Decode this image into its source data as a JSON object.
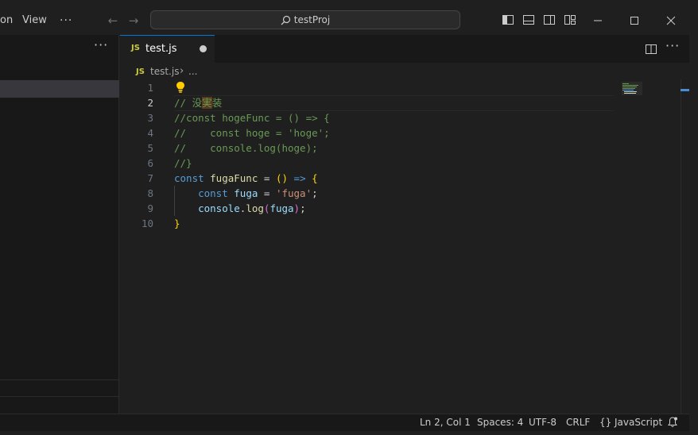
{
  "titlebar": {
    "menu": [
      "on",
      "View"
    ],
    "more": "···",
    "back": "←",
    "forward": "→",
    "search_text": "testProj",
    "icons": [
      "layout-left-icon",
      "layout-bottom-icon",
      "layout-right-icon",
      "customize-layout-icon"
    ],
    "window_buttons": [
      "minimize-icon",
      "maximize-icon",
      "close-icon"
    ]
  },
  "sidebar": {
    "more": "···"
  },
  "tabs": [
    {
      "icon": "JS",
      "label": "test.js",
      "dirty": true
    }
  ],
  "editor_actions": {
    "more": "···"
  },
  "breadcrumb": {
    "icon": "JS",
    "file": "test.js",
    "separator": "›",
    "more": "..."
  },
  "code": {
    "current_line": 2,
    "line_numbers": [
      "1",
      "2",
      "3",
      "4",
      "5",
      "6",
      "7",
      "8",
      "9",
      "10"
    ],
    "lines": [
      [],
      [
        {
          "t": "// 没",
          "c": "c-comment"
        },
        {
          "t": "実",
          "c": "c-hlchar"
        },
        {
          "t": "装",
          "c": "c-comment"
        }
      ],
      [
        {
          "t": "//const hogeFunc = () => {",
          "c": "c-comment"
        }
      ],
      [
        {
          "t": "//    const hoge = 'hoge';",
          "c": "c-comment"
        }
      ],
      [
        {
          "t": "//    console.log(hoge);",
          "c": "c-comment"
        }
      ],
      [
        {
          "t": "//}",
          "c": "c-comment"
        }
      ],
      [
        {
          "t": "const ",
          "c": "c-keyword"
        },
        {
          "t": "fugaFunc",
          "c": "c-func"
        },
        {
          "t": " = ",
          "c": "c-punct"
        },
        {
          "t": "()",
          "c": "c-brace"
        },
        {
          "t": " ",
          "c": "c-punct"
        },
        {
          "t": "=>",
          "c": "c-keyword"
        },
        {
          "t": " ",
          "c": "c-punct"
        },
        {
          "t": "{",
          "c": "c-brace"
        }
      ],
      [
        {
          "t": "    ",
          "c": "c-punct"
        },
        {
          "t": "const ",
          "c": "c-keyword"
        },
        {
          "t": "fuga",
          "c": "c-var"
        },
        {
          "t": " = ",
          "c": "c-punct"
        },
        {
          "t": "'fuga'",
          "c": "c-string"
        },
        {
          "t": ";",
          "c": "c-punct"
        }
      ],
      [
        {
          "t": "    ",
          "c": "c-punct"
        },
        {
          "t": "console",
          "c": "c-var"
        },
        {
          "t": ".",
          "c": "c-punct"
        },
        {
          "t": "log",
          "c": "c-func"
        },
        {
          "t": "(",
          "c": "c-paren"
        },
        {
          "t": "fuga",
          "c": "c-var"
        },
        {
          "t": ")",
          "c": "c-paren"
        },
        {
          "t": ";",
          "c": "c-punct"
        }
      ],
      [
        {
          "t": "}",
          "c": "c-brace"
        }
      ]
    ]
  },
  "status": {
    "position": "Ln 2, Col 1",
    "spaces": "Spaces: 4",
    "encoding": "UTF-8",
    "eol": "CRLF",
    "language_icon": "{}",
    "language": "JavaScript"
  },
  "colors": {
    "accent": "#0078d4",
    "js_icon": "#cbcb41",
    "comment": "#6a9955",
    "keyword": "#569cd6"
  }
}
